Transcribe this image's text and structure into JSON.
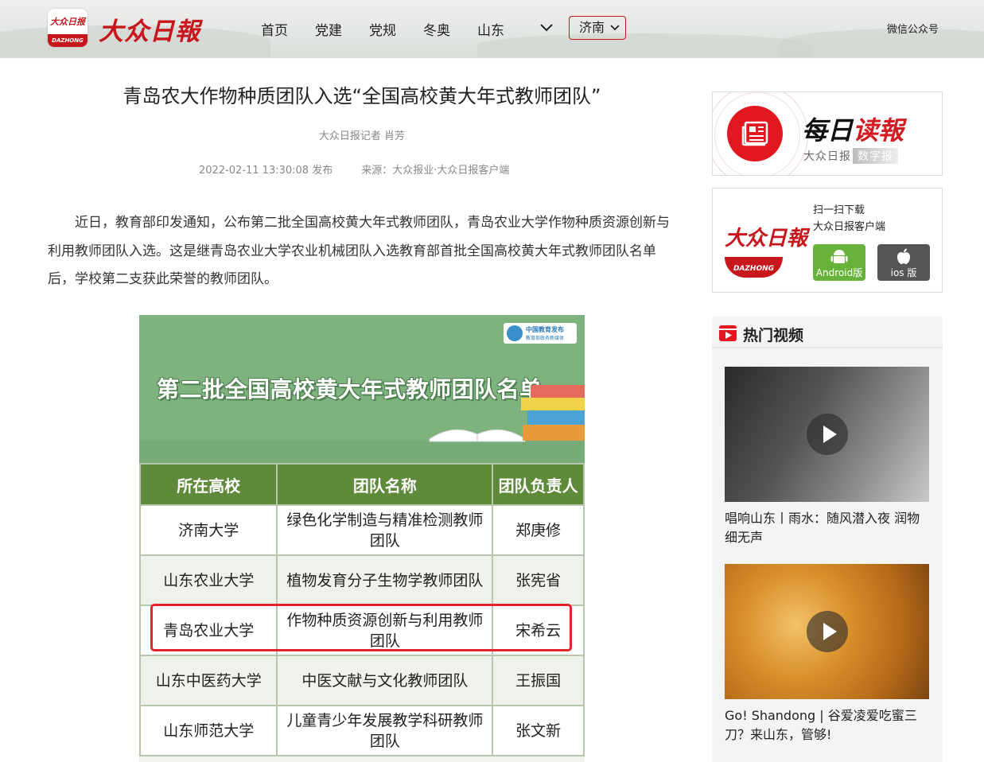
{
  "header": {
    "logo_box_text": "大众日报",
    "logo_box_sub": "DAZHONG",
    "brand": "大众日報",
    "nav": [
      "首页",
      "党建",
      "党规",
      "冬奥",
      "山东"
    ],
    "more_icon": "chevron-down-icon",
    "city": "济南",
    "wechat": "微信公众号"
  },
  "article": {
    "title": "青岛农大作物种质团队入选“全国高校黄大年式教师团队”",
    "byline": "大众日报记者 肖芳",
    "date": "2022-02-11 13:30:08 发布",
    "source": "来源：大众报业·大众日报客户端",
    "body": "近日，教育部印发通知，公布第二批全国高校黄大年式教师团队，青岛农业大学作物种质资源创新与利用教师团队入选。这是继青岛农业大学农业机械团队入选教育部首批全国高校黄大年式教师团队名单后，学校第二支获此荣誉的教师团队。"
  },
  "graphic": {
    "badge_title": "中国教育发布",
    "badge_sub": "教育部政务新媒体",
    "title": "第二批全国高校黄大年式教师团队名单",
    "headers": [
      "所在高校",
      "团队名称",
      "团队负责人"
    ],
    "rows": [
      [
        "济南大学",
        "绿色化学制造与精准检测教师团队",
        "郑庚修"
      ],
      [
        "山东农业大学",
        "植物发育分子生物学教师团队",
        "张宪省"
      ],
      [
        "青岛农业大学",
        "作物种质资源创新与利用教师团队",
        "宋希云"
      ],
      [
        "山东中医药大学",
        "中医文献与文化教师团队",
        "王振国"
      ],
      [
        "山东师范大学",
        "儿童青少年发展教学科研教师团队",
        "张文新"
      ]
    ],
    "highlight_color": "#e0262a",
    "header_color": "#5f8a3a"
  },
  "sidebar": {
    "daily_title_a": "每日",
    "daily_title_b": "读報",
    "daily_sub": "大众日报",
    "daily_tag": "数字报",
    "app_logo": "大众日報",
    "app_logo_sub": "DAZHONG",
    "scan_line1": "扫一扫下载",
    "scan_line2": "大众日报客户端",
    "android_label": "Android版",
    "ios_label": "ios 版",
    "hot_title": "热门视频",
    "videos": [
      {
        "caption": "唱响山东丨雨水：随风潜入夜 润物细无声"
      },
      {
        "caption": "Go! Shandong | 谷爱凌爱吃蜜三刀？来山东，管够!"
      }
    ]
  },
  "colors": {
    "brand_red": "#c8161d"
  }
}
